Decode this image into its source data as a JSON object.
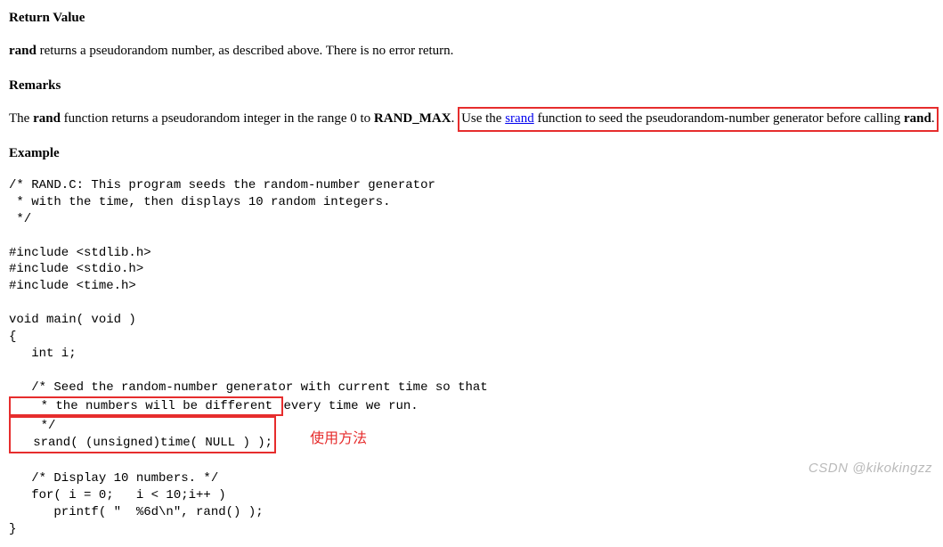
{
  "return_value": {
    "heading": "Return Value",
    "para_prefix": "rand",
    "para_rest": " returns a pseudorandom number, as described above. There is no error return."
  },
  "remarks": {
    "heading": "Remarks",
    "s1_pre": "The ",
    "s1_bold": "rand",
    "s1_mid": " function returns a pseudorandom integer in the range 0 to ",
    "s1_bold2": "RAND_MAX",
    "s1_post": ". ",
    "box_pre": "Use the ",
    "box_link": "srand",
    "box_mid": " function to seed the pseudorandom-number generator before calling ",
    "box_bold": "rand",
    "box_end": "."
  },
  "example": {
    "heading": "Example"
  },
  "code": {
    "l01": "/* RAND.C: This program seeds the random-number generator",
    "l02": " * with the time, then displays 10 random integers.",
    "l03": " */",
    "l04": "",
    "l05": "#include <stdlib.h>",
    "l06": "#include <stdio.h>",
    "l07": "#include <time.h>",
    "l08": "",
    "l09": "void main( void )",
    "l10": "{",
    "l11": "   int i;",
    "l12": "",
    "l13": "   /* Seed the random-number generator with current time so that",
    "hb1": "    * the numbers will be different ",
    "hb1_rest": "every time we run.",
    "hb2": "    */",
    "hb3": "   srand( (unsigned)time( NULL ) );",
    "annot": "使用方法",
    "l14": "",
    "l15": "   /* Display 10 numbers. */",
    "l16": "   for( i = 0;   i < 10;i++ )",
    "l17": "      printf( \"  %6d\\n\", rand() );",
    "l18": "}"
  },
  "watermark": "CSDN @kikokingzz"
}
